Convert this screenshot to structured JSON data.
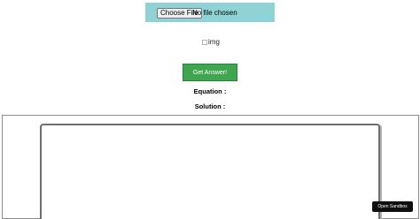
{
  "upload": {
    "button_label": "Choose File",
    "status_text": "No file chosen"
  },
  "image_option": {
    "label": "img",
    "checked": false
  },
  "actions": {
    "get_answer_label": "Get Answer!"
  },
  "results": {
    "equation_label": "Equation :",
    "solution_label": "Solution :"
  },
  "footer": {
    "open_sandbox_label": "Open Sandbox"
  },
  "colors": {
    "upload_bar_bg": "#8fd3d6",
    "get_answer_bg": "#3fa54e",
    "sandbox_button_bg": "#0f0f0f"
  }
}
